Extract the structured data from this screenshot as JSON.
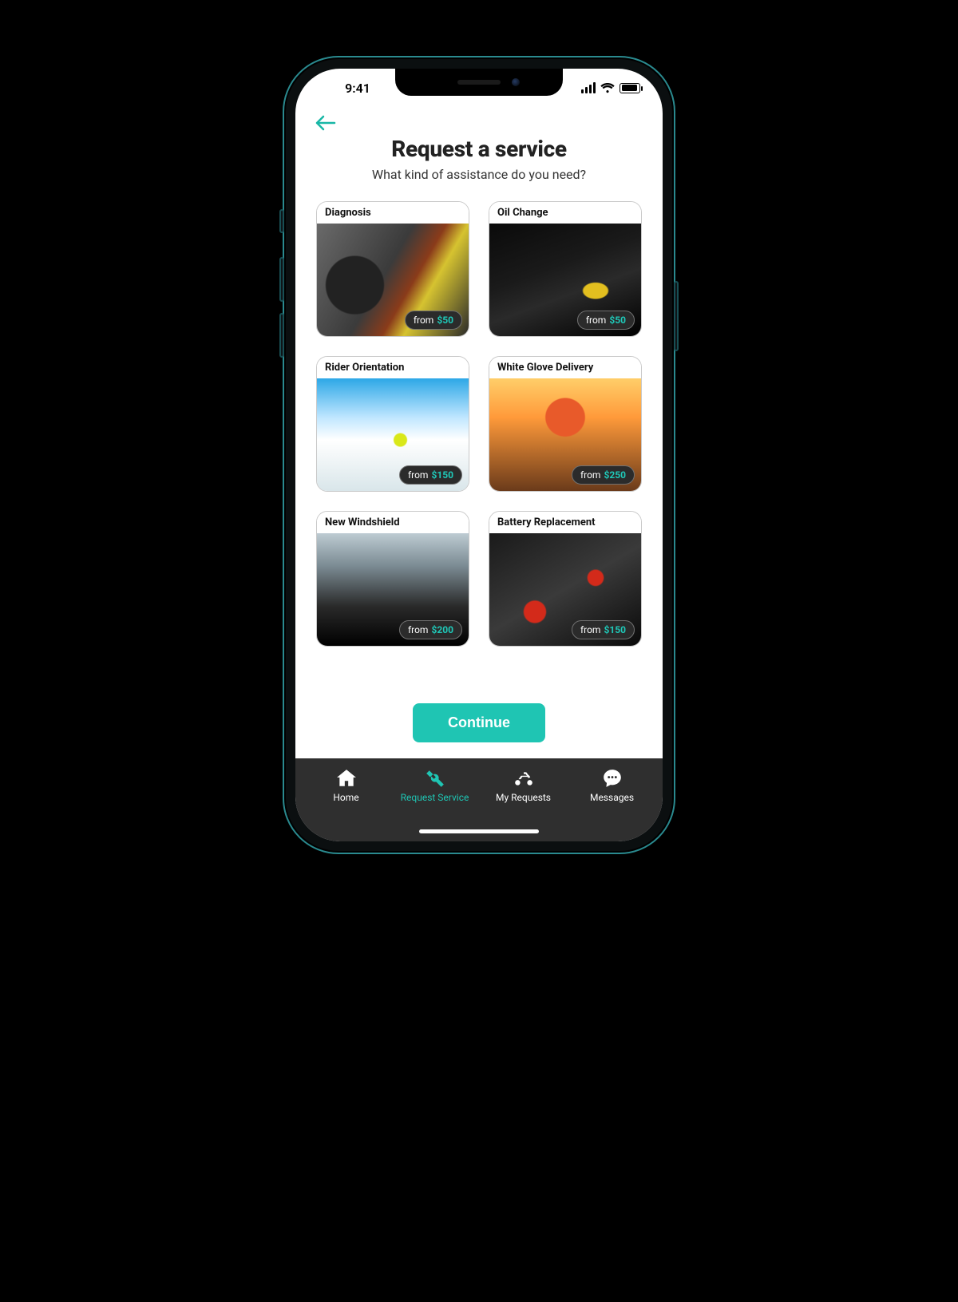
{
  "status": {
    "time": "9:41"
  },
  "header": {
    "title": "Request a service",
    "subtitle": "What kind of assistance do you need?"
  },
  "price_prefix": "from",
  "services": [
    {
      "title": "Diagnosis",
      "price": "$50",
      "img_class": "img-diagnosis",
      "name": "service-card-diagnosis"
    },
    {
      "title": "Oil Change",
      "price": "$50",
      "img_class": "img-oil",
      "name": "service-card-oil-change"
    },
    {
      "title": "Rider Orientation",
      "price": "$150",
      "img_class": "img-rider",
      "name": "service-card-rider-orientation"
    },
    {
      "title": "White Glove Delivery",
      "price": "$250",
      "img_class": "img-whiteglove",
      "name": "service-card-white-glove-delivery"
    },
    {
      "title": "New Windshield",
      "price": "$200",
      "img_class": "img-windshield",
      "name": "service-card-new-windshield"
    },
    {
      "title": "Battery Replacement",
      "price": "$150",
      "img_class": "img-battery",
      "name": "service-card-battery-replacement"
    }
  ],
  "cta": {
    "continue": "Continue"
  },
  "nav": {
    "home": "Home",
    "request": "Request Service",
    "mine": "My Requests",
    "messages": "Messages",
    "active": "request"
  }
}
